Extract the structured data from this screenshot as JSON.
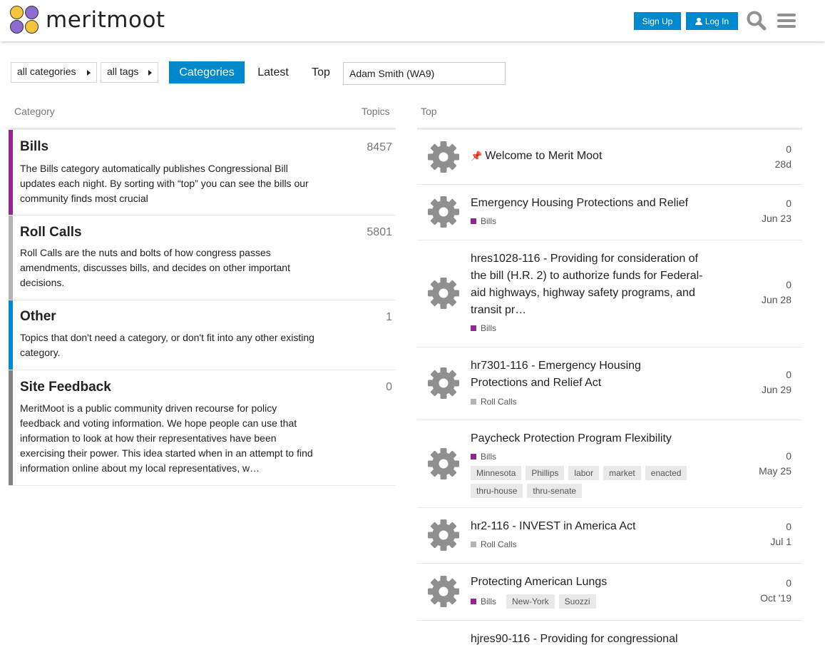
{
  "header": {
    "logo_text": "meritmoot",
    "signup_label": "Sign Up",
    "login_label": "Log In",
    "icons": [
      "search-icon",
      "hamburger-menu-icon",
      "user-icon"
    ]
  },
  "nav": {
    "categories_dropdown": "all categories",
    "tags_dropdown": "all tags",
    "tab_categories": "Categories",
    "tab_latest": "Latest",
    "tab_top": "Top",
    "search_value": "Adam Smith (WA9)"
  },
  "table_headers": {
    "category": "Category",
    "topics": "Topics",
    "top": "Top"
  },
  "categories": [
    {
      "name": "Bills",
      "color": "#92278f",
      "count": "8457",
      "description": "The Bills category automatically publishes Congressional Bill updates each night. By sorting with “top” you can see the bills our community finds most crucial"
    },
    {
      "name": "Roll Calls",
      "color": "#b3b3b3",
      "count": "5801",
      "description": "Roll Calls are the nuts and bolts of how congress passes amendments, discusses bills, and decides on other important decisions."
    },
    {
      "name": "Other",
      "color": "#0088cc",
      "count": "1",
      "description": "Topics that don't need a category, or don't fit into any other existing category."
    },
    {
      "name": "Site Feedback",
      "color": "#808281",
      "count": "0",
      "description": "MeritMoot is a public community driven recourse for policy feedback and voting information. We hope people can use that information to look at how their representatives have been exercising their power. This idea started when in an attempt to find information online about my local representatives, w…"
    }
  ],
  "topics": [
    {
      "title": "Welcome to Merit Moot",
      "pinned": true,
      "category": "",
      "tags": [],
      "replies": "0",
      "age": "28d"
    },
    {
      "title": "Emergency Housing Protections and Relief",
      "pinned": false,
      "category": "Bills",
      "tags": [],
      "replies": "0",
      "age": "Jun 23"
    },
    {
      "title": "hres1028-116 - Providing for consideration of the bill (H.R. 2) to authorize funds for Federal-aid highways, highway safety programs, and transit pr…",
      "pinned": false,
      "category": "Bills",
      "tags": [],
      "replies": "0",
      "age": "Jun 28"
    },
    {
      "title": "hr7301-116 - Emergency Housing Protections and Relief Act",
      "pinned": false,
      "category": "Roll Calls",
      "tags": [],
      "replies": "0",
      "age": "Jun 29"
    },
    {
      "title": "Paycheck Protection Program Flexibility",
      "pinned": false,
      "category": "Bills",
      "tags": [
        "Minnesota",
        "Phillips",
        "labor",
        "market",
        "enacted",
        "thru-house",
        "thru-senate"
      ],
      "replies": "0",
      "age": "May 25"
    },
    {
      "title": "hr2-116 - INVEST in America Act",
      "pinned": false,
      "category": "Roll Calls",
      "tags": [],
      "replies": "0",
      "age": "Jul 1"
    },
    {
      "title": "Protecting American Lungs",
      "pinned": false,
      "category": "Bills",
      "tags": [
        "New-York",
        "Suozzi"
      ],
      "replies": "0",
      "age": "Oct '19"
    },
    {
      "title": "hjres90-116 - Providing for congressional",
      "pinned": false,
      "category": "",
      "tags": [],
      "replies": "",
      "age": ""
    }
  ],
  "colors": {
    "accent": "#0088cc",
    "bills": "#92278f",
    "roll_calls": "#b3b3b3",
    "other": "#0088cc",
    "site_feedback": "#808281"
  }
}
